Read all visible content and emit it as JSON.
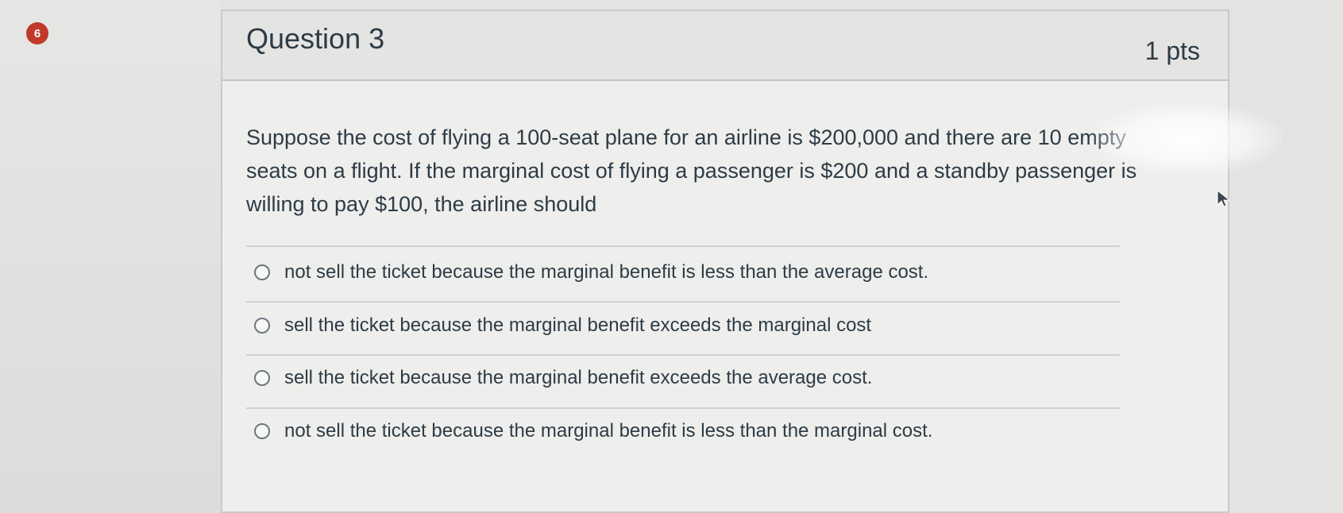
{
  "question": {
    "number_badge": "6",
    "title": "Question 3",
    "points": "1 pts",
    "text": "Suppose the cost of flying a 100-seat plane for an airline is $200,000 and there are 10 empty seats on a flight. If the marginal cost of flying a passenger is $200 and a standby passenger is willing to pay $100, the airline should"
  },
  "answers": [
    {
      "label": "not sell the ticket because the marginal benefit is less than the average cost."
    },
    {
      "label": "sell the ticket because the marginal benefit exceeds the marginal cost"
    },
    {
      "label": "sell the ticket because the marginal benefit exceeds the average cost."
    },
    {
      "label": "not sell the ticket because the marginal benefit is less than the marginal cost."
    }
  ],
  "colors": {
    "badge": "#c0392b",
    "text": "#2d3b45",
    "header_bg": "#e4e4e2",
    "card_bg": "#eeeeec"
  },
  "icons": {
    "cursor": "mouse-pointer-icon",
    "radio": "radio-button-icon"
  }
}
